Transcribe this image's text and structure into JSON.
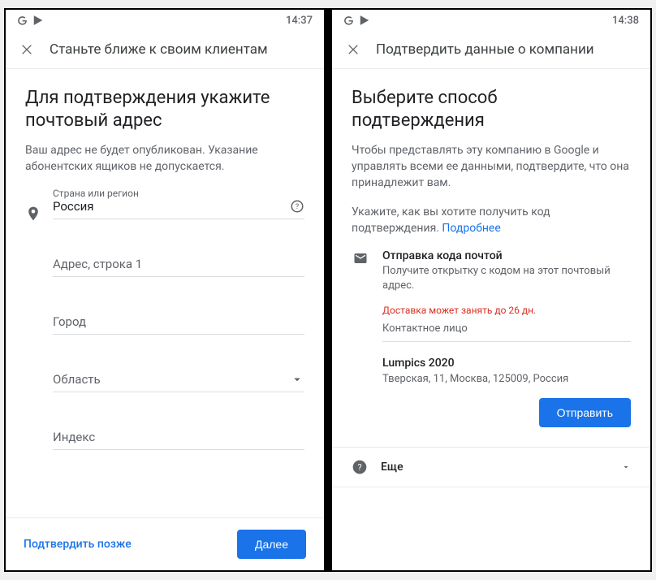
{
  "left": {
    "status_time": "14:37",
    "titlebar": "Станьте ближе к своим клиентам",
    "heading": "Для подтверждения укажите почтовый адрес",
    "subtext": "Ваш адрес не будет опубликован. Указание абонентских ящиков не допускается.",
    "fields": {
      "country_label": "Страна или регион",
      "country_value": "Россия",
      "address1_placeholder": "Адрес, строка 1",
      "city_placeholder": "Город",
      "region_placeholder": "Область",
      "postal_placeholder": "Индекс"
    },
    "later_label": "Подтвердить позже",
    "next_label": "Далее"
  },
  "right": {
    "status_time": "14:38",
    "titlebar": "Подтвердить данные о компании",
    "heading": "Выберите способ подтверждения",
    "subtext1": "Чтобы представлять эту компанию в Google и управлять всеми ее данными, подтвердите, что она принадлежит вам.",
    "subtext2_prefix": "Укажите, как вы хотите получить код подтверждения. ",
    "subtext2_link": "Подробнее",
    "verify": {
      "title": "Отправка кода почтой",
      "desc": "Получите открытку с кодом на этот почтовый адрес.",
      "warn": "Доставка может занять до 26 дн.",
      "contact_placeholder": "Контактное лицо",
      "biz_name": "Lumpics 2020",
      "biz_addr": "Тверская, 11, Москва, 125009, Россия",
      "send_label": "Отправить"
    },
    "more_label": "Еще"
  }
}
